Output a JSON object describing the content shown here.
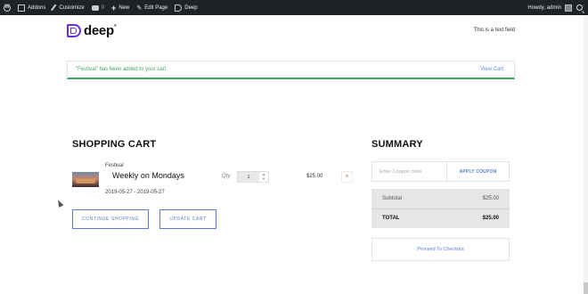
{
  "admin_bar": {
    "items": [
      {
        "icon": "wordpress-icon",
        "label": ""
      },
      {
        "icon": "home-icon",
        "label": "Addons"
      },
      {
        "icon": "brush-icon",
        "label": "Customize"
      },
      {
        "icon": "comment-icon",
        "label": "0"
      },
      {
        "icon": "plus-icon",
        "label": "New"
      },
      {
        "icon": "pencil-icon",
        "label": "Edit Page"
      },
      {
        "icon": "deep-icon",
        "label": "Deep"
      }
    ],
    "user_label": "Howdy, admin"
  },
  "header": {
    "logo_text": "deep",
    "logo_mark": "®",
    "text_field": "This is a text field"
  },
  "notice": {
    "message": "\"Festival\" has been added to your cart.",
    "link": "View Cart"
  },
  "cart": {
    "title": "SHOPPING CART",
    "item": {
      "category": "Festival",
      "name": "Weekly on Mondays",
      "dates": "2019-05-27 - 2019-05-27",
      "qty_label": "Qty",
      "qty": "1",
      "price": "$25.00",
      "remove": "×"
    },
    "continue_label": "CONTINUE SHOPPING",
    "update_label": "UPDATE CART"
  },
  "summary": {
    "title": "SUMMARY",
    "coupon_placeholder": "Enter Coupon code",
    "apply_label": "APPLY COUPON",
    "subtotal_label": "Subtotal",
    "subtotal_value": "$25.00",
    "total_label": "TOTAL",
    "total_value": "$25.00",
    "checkout_label": "Proceed To Checkout"
  }
}
